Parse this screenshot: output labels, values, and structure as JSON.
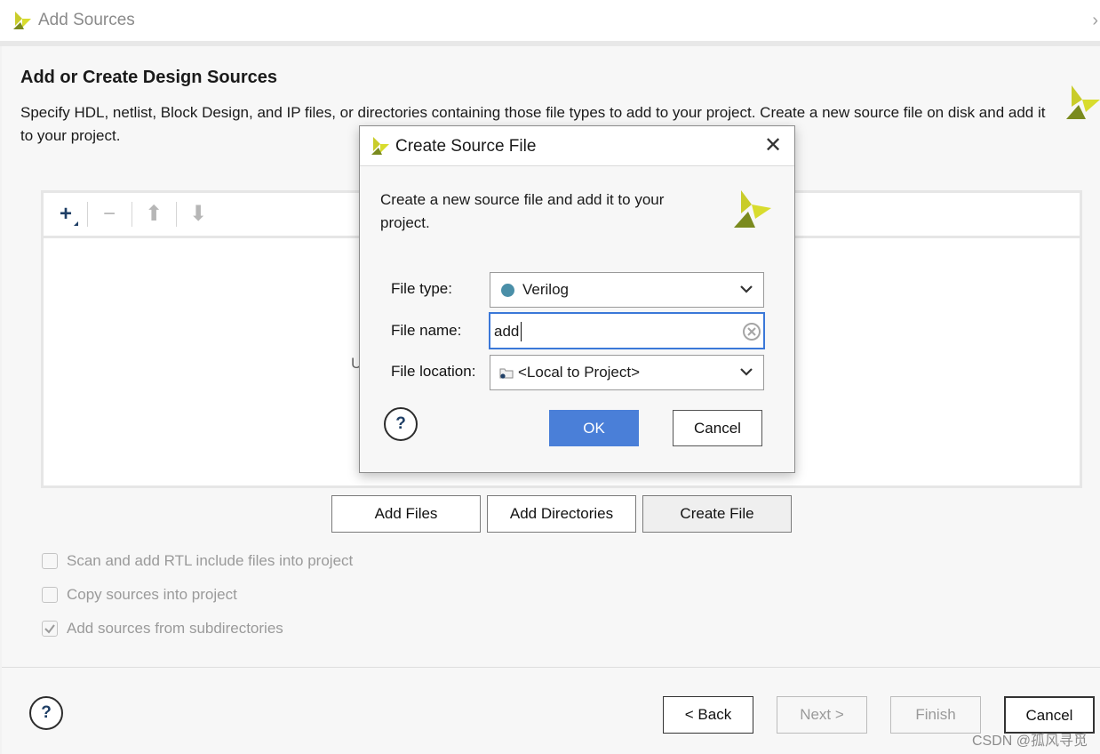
{
  "window": {
    "title": "Add Sources"
  },
  "page": {
    "heading": "Add or Create Design Sources",
    "description": "Specify HDL, netlist, Block Design, and IP files, or directories containing those file types to add to your project. Create a new source file on disk and add it to your project.",
    "hidden_hint_fragment": "U"
  },
  "toolbar": {
    "icons": [
      "add-icon",
      "remove-icon",
      "move-up-icon",
      "move-down-icon"
    ]
  },
  "source_buttons": {
    "add_files": "Add Files",
    "add_directories": "Add Directories",
    "create_file": "Create File"
  },
  "options": [
    {
      "label": "Scan and add RTL include files into project",
      "checked": false
    },
    {
      "label": "Copy sources into project",
      "checked": false
    },
    {
      "label": "Add sources from subdirectories",
      "checked": true
    }
  ],
  "footer": {
    "help": "?",
    "back": "< Back",
    "next": "Next >",
    "finish": "Finish",
    "cancel": "Cancel"
  },
  "dialog": {
    "title": "Create Source File",
    "description": "Create a new source file and add it to your project.",
    "file_type_label": "File type:",
    "file_type_value": "Verilog",
    "file_type_dot_color": "#4a8fa8",
    "file_name_label": "File name:",
    "file_name_value": "add",
    "file_location_label": "File location:",
    "file_location_value": "<Local to Project>",
    "help": "?",
    "ok": "OK",
    "cancel": "Cancel"
  },
  "watermark": "CSDN @孤风寻觅",
  "colors": {
    "accent": "#4a7fd8",
    "focus_border": "#3b78d8",
    "logo_yellow": "#c9cc2a",
    "logo_green": "#7a8a1e"
  }
}
